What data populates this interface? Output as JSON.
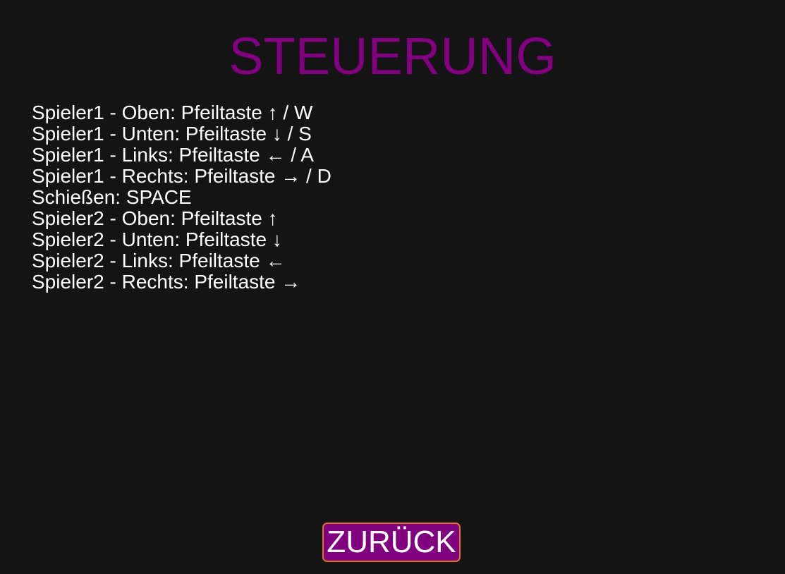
{
  "screen": {
    "title": "STEUERUNG",
    "controls": [
      "Spieler1 - Oben: Pfeiltaste ↑ / W",
      "Spieler1 - Unten: Pfeiltaste ↓ / S",
      "Spieler1 - Links: Pfeiltaste ← / A",
      "Spieler1 - Rechts: Pfeiltaste → / D",
      "Schießen: SPACE",
      "Spieler2 - Oben: Pfeiltaste ↑",
      "Spieler2 - Unten: Pfeiltaste ↓",
      "Spieler2 - Links: Pfeiltaste ←",
      "Spieler2 - Rechts: Pfeiltaste →"
    ],
    "back_label": "ZURÜCK"
  },
  "colors": {
    "background": "#141414",
    "title": "#800080",
    "text": "#ffffff",
    "button_fill": "#800080",
    "button_border": "#e0731e"
  }
}
